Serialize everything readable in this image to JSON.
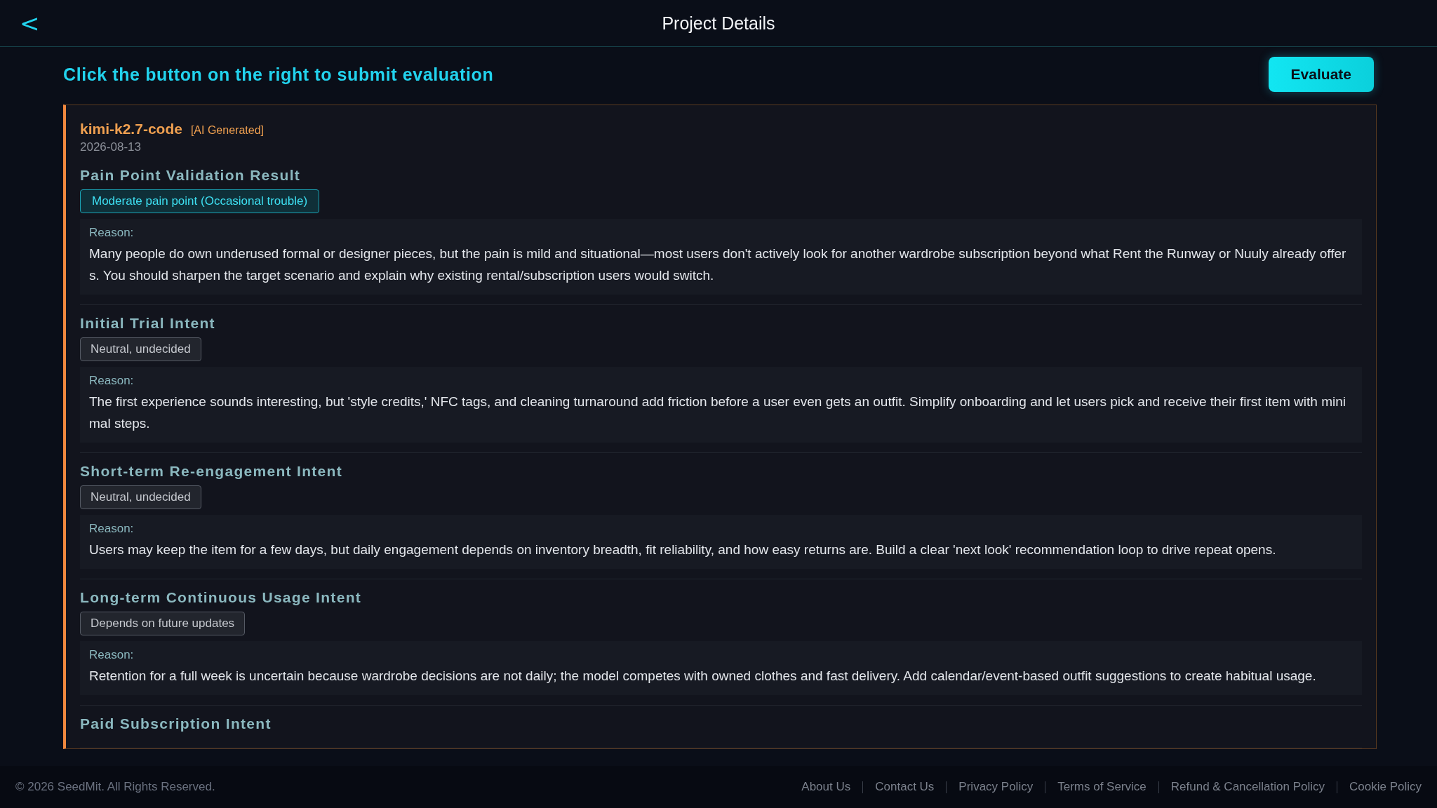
{
  "header": {
    "back": "<",
    "title": "Project Details"
  },
  "prompt": "Click the button on the right to submit evaluation",
  "evaluate_button": "Evaluate",
  "evaluation": {
    "model": "kimi-k2.7-code",
    "tag": "[AI Generated]",
    "date": "2026-08-13",
    "sections": [
      {
        "title": "Pain Point Validation Result",
        "verdict": {
          "text": "Moderate pain point (Occasional trouble)",
          "kind": "highlight"
        },
        "reason_label": "Reason:",
        "reason": "Many people do own underused formal or designer pieces, but the pain is mild and situational—most users don't actively look for another wardrobe subscription beyond what Rent the Runway or Nuuly already offers. You should sharpen the target scenario and explain why existing rental/subscription users would switch."
      },
      {
        "title": "Initial Trial Intent",
        "verdict": {
          "text": "Neutral, undecided",
          "kind": "neutral"
        },
        "reason_label": "Reason:",
        "reason": "The first experience sounds interesting, but 'style credits,' NFC tags, and cleaning turnaround add friction before a user even gets an outfit. Simplify onboarding and let users pick and receive their first item with minimal steps."
      },
      {
        "title": "Short-term Re-engagement Intent",
        "verdict": {
          "text": "Neutral, undecided",
          "kind": "neutral"
        },
        "reason_label": "Reason:",
        "reason": "Users may keep the item for a few days, but daily engagement depends on inventory breadth, fit reliability, and how easy returns are. Build a clear 'next look' recommendation loop to drive repeat opens."
      },
      {
        "title": "Long-term Continuous Usage Intent",
        "verdict": {
          "text": "Depends on future updates",
          "kind": "neutral"
        },
        "reason_label": "Reason:",
        "reason": "Retention for a full week is uncertain because wardrobe decisions are not daily; the model competes with owned clothes and fast delivery. Add calendar/event-based outfit suggestions to create habitual usage."
      },
      {
        "title": "Paid Subscription Intent"
      }
    ]
  },
  "footer": {
    "copyright": "© 2026 SeedMit. All Rights Reserved.",
    "links": [
      "About Us",
      "Contact Us",
      "Privacy Policy",
      "Terms of Service",
      "Refund & Cancellation Policy",
      "Cookie Policy"
    ]
  }
}
